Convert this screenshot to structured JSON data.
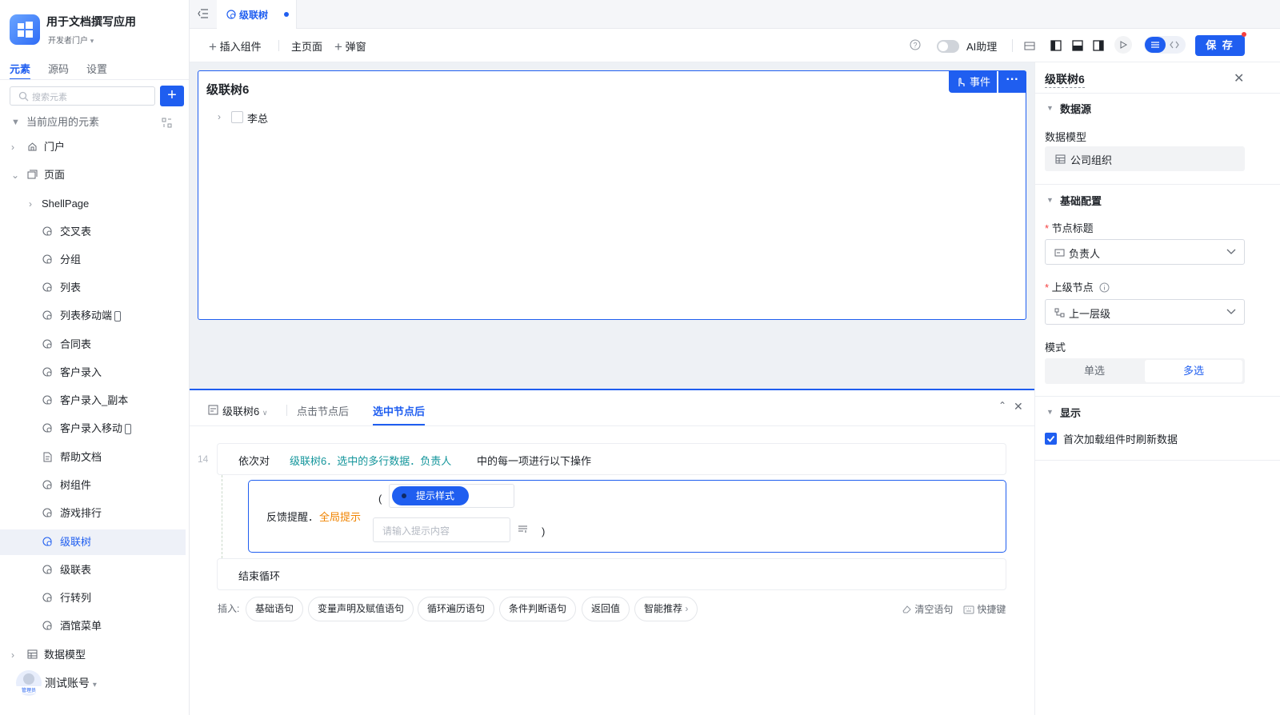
{
  "app": {
    "title": "用于文档撰写应用",
    "subtitle": "开发者门户"
  },
  "sidebar": {
    "tabs": [
      "元素",
      "源码",
      "设置"
    ],
    "search_placeholder": "搜索元素",
    "section_label": "当前应用的元素",
    "items": [
      {
        "label": "门户",
        "icon": "home-icon"
      },
      {
        "label": "页面",
        "icon": "pages-icon"
      },
      {
        "label": "ShellPage",
        "icon": ""
      },
      {
        "label": "交叉表",
        "icon": "page-icon"
      },
      {
        "label": "分组",
        "icon": "page-icon"
      },
      {
        "label": "列表",
        "icon": "page-icon"
      },
      {
        "label": "列表移动端",
        "icon": "page-icon"
      },
      {
        "label": "合同表",
        "icon": "page-icon"
      },
      {
        "label": "客户录入",
        "icon": "page-icon"
      },
      {
        "label": "客户录入_副本",
        "icon": "page-icon"
      },
      {
        "label": "客户录入移动",
        "icon": "page-icon"
      },
      {
        "label": "帮助文档",
        "icon": "doc-icon"
      },
      {
        "label": "树组件",
        "icon": "page-icon"
      },
      {
        "label": "游戏排行",
        "icon": "page-icon"
      },
      {
        "label": "级联树",
        "icon": "page-icon"
      },
      {
        "label": "级联表",
        "icon": "page-icon"
      },
      {
        "label": "行转列",
        "icon": "page-icon"
      },
      {
        "label": "酒馆菜单",
        "icon": "page-icon"
      },
      {
        "label": "数据模型",
        "icon": "table-icon"
      }
    ],
    "user": {
      "name": "测试账号",
      "badge": "管理员"
    }
  },
  "topbar": {
    "tab_label": "级联树"
  },
  "toolbar": {
    "insert": "插入组件",
    "home": "主页面",
    "popup": "弹窗",
    "ai": "AI助理",
    "save": "保 存"
  },
  "canvas": {
    "component_title": "级联树6",
    "event_btn": "事件",
    "tree_node": "李总"
  },
  "bottom": {
    "tabs": [
      "级联树6",
      "点击节点后",
      "选中节点后"
    ],
    "line_no": "14",
    "loop_prefix": "依次对",
    "loop_expr": "级联树6．选中的多行数据．负责人",
    "loop_suffix": "中的每一项进行以下操作",
    "action_label": "反馈提醒．",
    "action_name": "全局提示",
    "style_chip": "提示样式",
    "content_placeholder": "请输入提示内容",
    "end_loop": "结束循环",
    "insert_label": "插入:",
    "chips": [
      "基础语句",
      "变量声明及赋值语句",
      "循环遍历语句",
      "条件判断语句",
      "返回值",
      "智能推荐"
    ],
    "clear": "清空语句",
    "shortcut": "快捷键"
  },
  "right": {
    "title": "级联树6",
    "sec_datasource": "数据源",
    "data_model_label": "数据模型",
    "data_model_value": "公司组织",
    "sec_basic": "基础配置",
    "node_title_label": "节点标题",
    "node_title_value": "负责人",
    "parent_label": "上级节点",
    "parent_value": "上一层级",
    "mode_label": "模式",
    "mode_single": "单选",
    "mode_multi": "多选",
    "sec_display": "显示",
    "refresh_label": "首次加载组件时刷新数据"
  },
  "colors": {
    "accent": "#1f5ef0",
    "orange": "#f08300",
    "teal": "#13959b"
  }
}
